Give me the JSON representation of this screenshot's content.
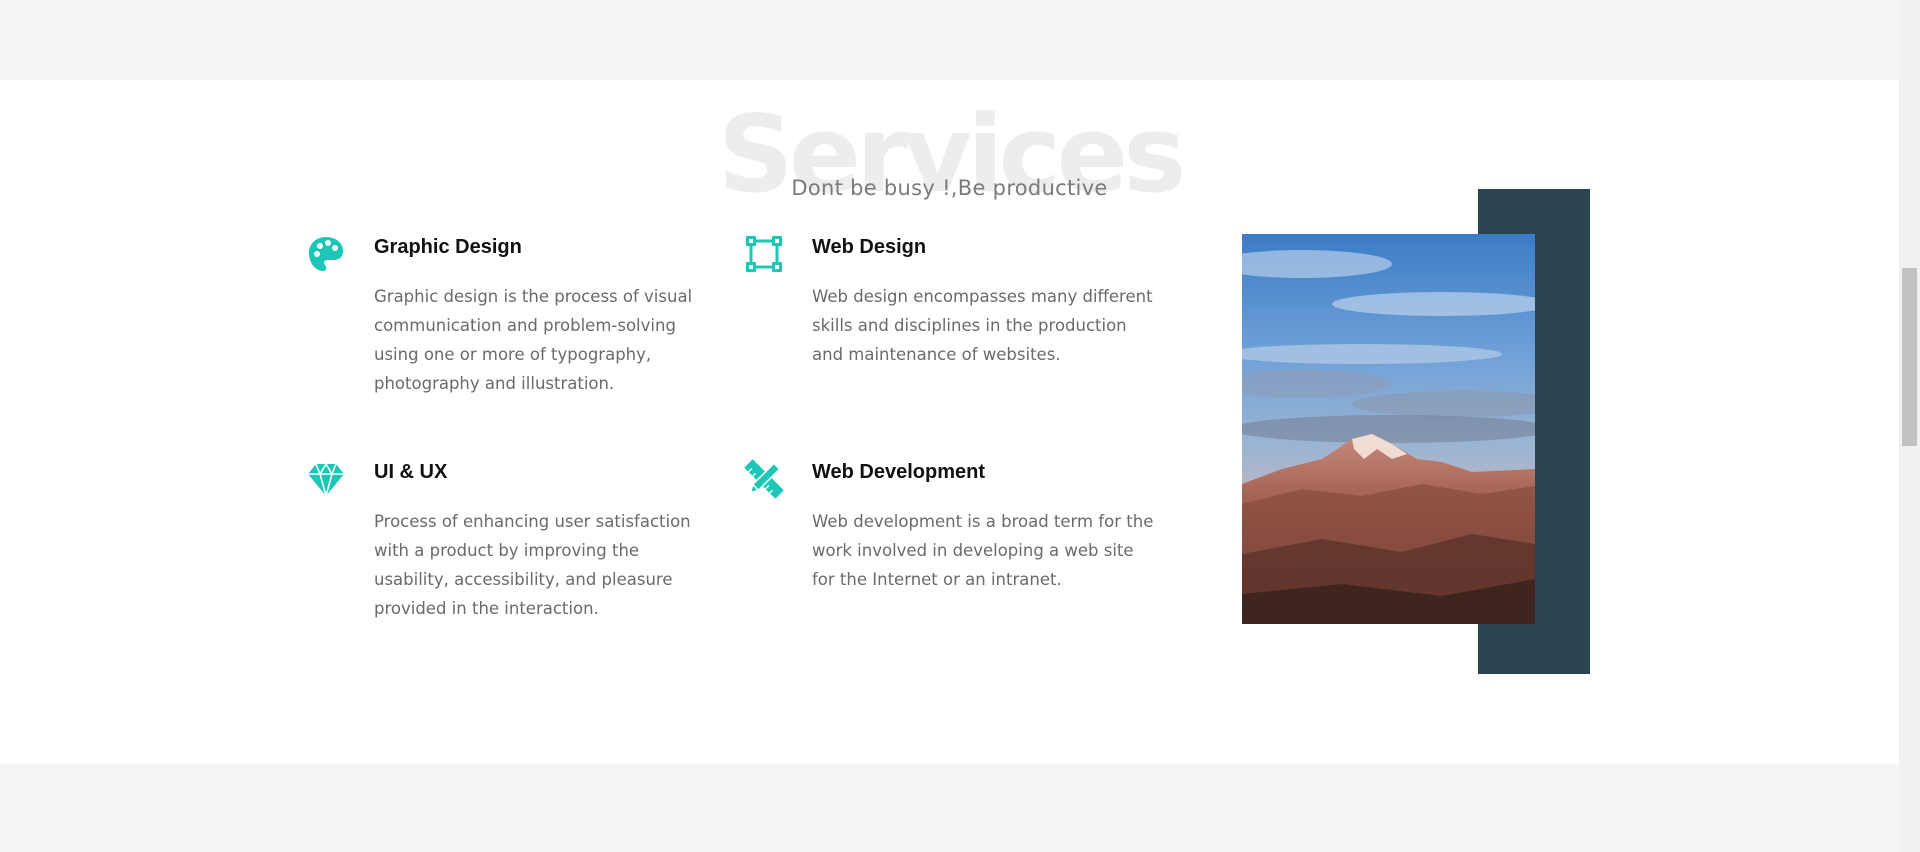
{
  "section": {
    "watermark": "Services",
    "subtitle": "Dont be busy !,Be productive"
  },
  "services": [
    {
      "icon": "palette-icon",
      "title": "Graphic Design",
      "description": "Graphic design is the process of visual communication and problem-solving using one or more of typography, photography and illustration."
    },
    {
      "icon": "vector-square-icon",
      "title": "Web Design",
      "description": "Web design encompasses many different skills and disciplines in the production and maintenance of websites."
    },
    {
      "icon": "gem-icon",
      "title": "UI & UX",
      "description": "Process of enhancing user satisfaction with a product by improving the usability, accessibility, and pleasure provided in the interaction."
    },
    {
      "icon": "pencil-ruler-icon",
      "title": "Web Development",
      "description": "Web development is a broad term for the work involved in developing a web site for the Internet or an intranet."
    }
  ],
  "colors": {
    "accent": "#1cc7b7",
    "dark_block": "#2b4452",
    "heading": "#111111",
    "body_text": "#6a6a6a",
    "watermark": "#ebedef",
    "page_bg": "#f5f5f5"
  }
}
